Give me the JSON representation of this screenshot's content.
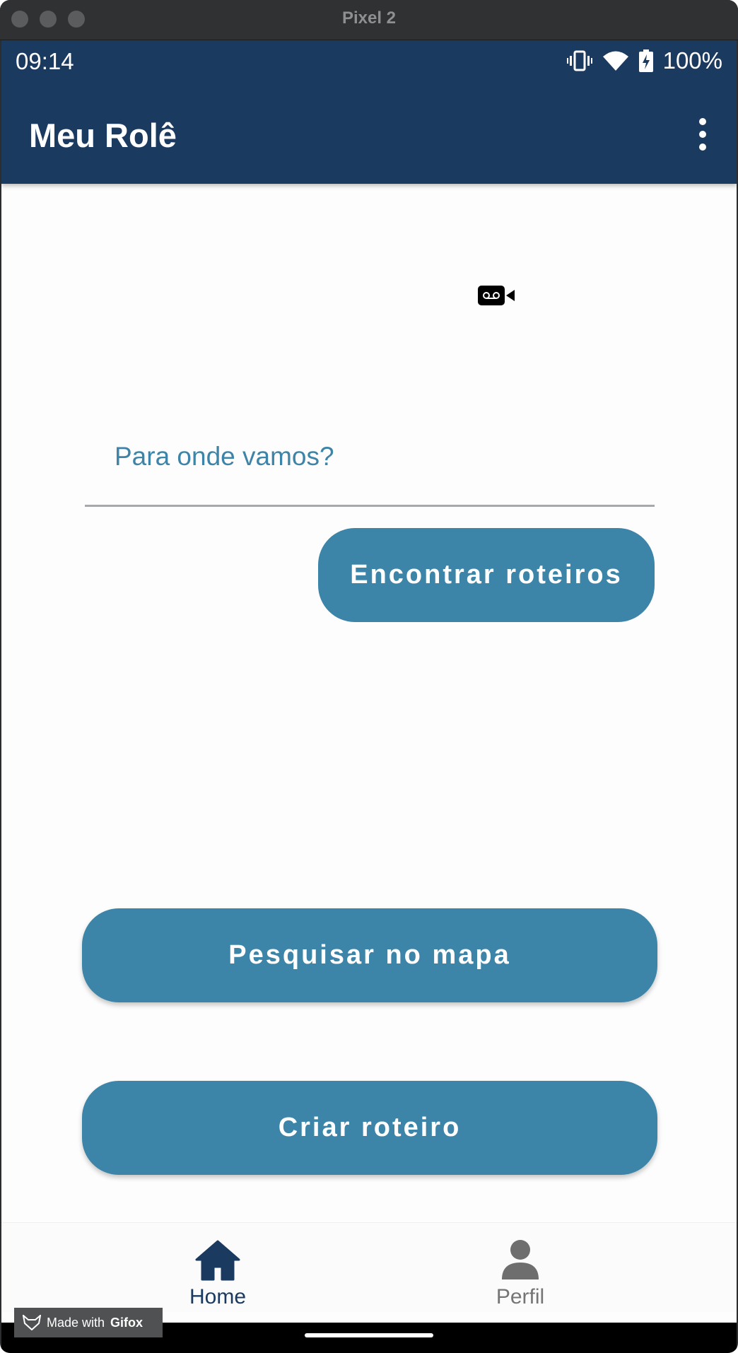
{
  "window": {
    "title": "Pixel 2"
  },
  "status_bar": {
    "time": "09:14",
    "battery": "100%",
    "icons": [
      "vibrate-icon",
      "wifi-icon",
      "battery-charging-icon"
    ]
  },
  "app_bar": {
    "title": "Meu Rolê",
    "menu_icon": "more-vert-icon"
  },
  "search": {
    "placeholder": "Para onde vamos?"
  },
  "buttons": {
    "find_routes": "Encontrar roteiros",
    "search_map": "Pesquisar no mapa",
    "create_route": "Criar roteiro"
  },
  "bottom_nav": {
    "items": [
      {
        "label": "Home",
        "icon": "home-icon",
        "active": true
      },
      {
        "label": "Perfil",
        "icon": "person-icon",
        "active": false
      }
    ]
  },
  "watermark": {
    "prefix": "Made with",
    "brand": "Gifox"
  },
  "colors": {
    "app_bar": "#1b3a60",
    "button": "#3c84a8",
    "accent_text": "#3d84a8",
    "nav_active": "#1b3a60",
    "nav_inactive": "#757575"
  }
}
